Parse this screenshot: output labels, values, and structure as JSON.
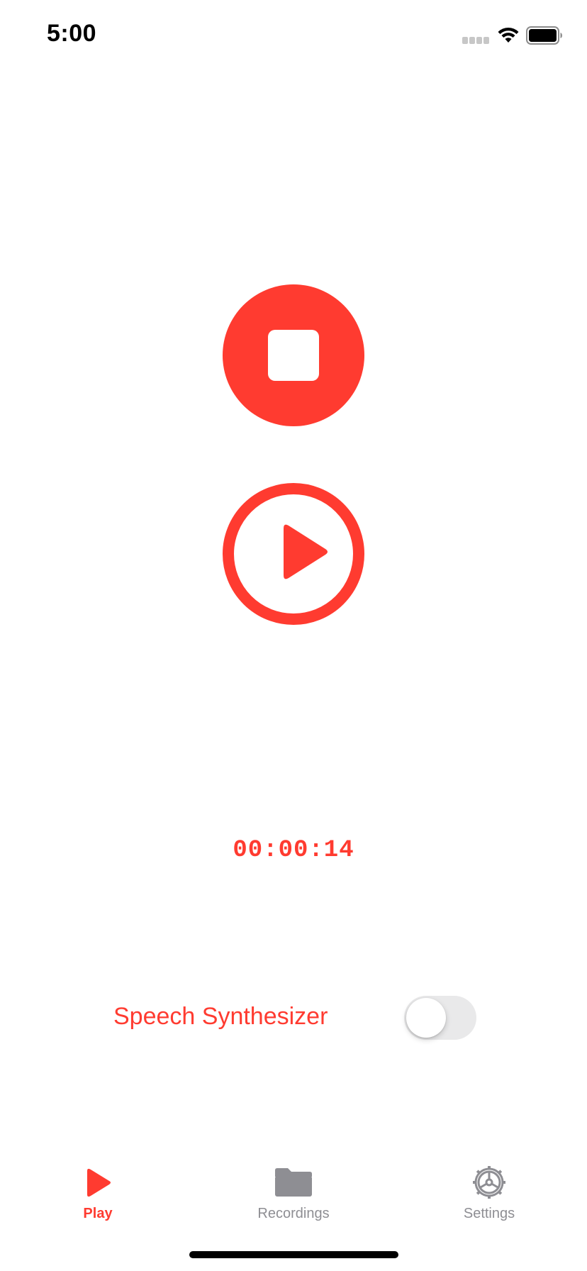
{
  "status_bar": {
    "time": "5:00"
  },
  "player": {
    "timer": "00:00:14"
  },
  "speech": {
    "label": "Speech Synthesizer",
    "enabled": false
  },
  "tab_bar": {
    "tabs": [
      {
        "label": "Play",
        "icon": "play-icon",
        "active": true
      },
      {
        "label": "Recordings",
        "icon": "folder-icon",
        "active": false
      },
      {
        "label": "Settings",
        "icon": "gear-icon",
        "active": false
      }
    ]
  },
  "colors": {
    "accent": "#ff3b30",
    "inactive": "#8e8e93",
    "toggle_off": "#e9e9ea"
  }
}
